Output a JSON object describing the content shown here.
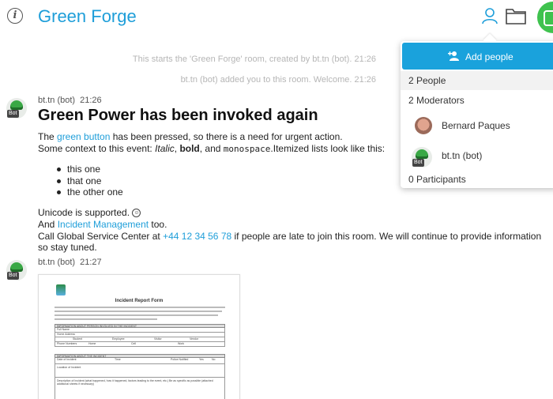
{
  "header": {
    "info_icon": "info-icon",
    "title": "Green Forge",
    "icons": [
      "person-icon",
      "folder-icon"
    ]
  },
  "system": {
    "created": "This starts the 'Green Forge' room, created by bt.tn (bot). 21:26",
    "added": "bt.tn (bot) added you to this room. Welcome. 21:26"
  },
  "message1": {
    "author": "bt.tn (bot)",
    "time": "21:26",
    "badge": "Bot",
    "heading": "Green Power has been invoked again",
    "line1_pre": "The ",
    "line1_link": "green button",
    "line1_post": " has been pressed, so there is a need for urgent action.",
    "line2_pre": "Some context to this event: ",
    "italic": "Italic",
    "sep1": ", ",
    "bold": "bold",
    "sep2": ", and ",
    "mono": "monospace",
    "line2_post": ".Itemized lists look like this:",
    "bullets": [
      "this one",
      "that one",
      "the other one"
    ],
    "unicode": "Unicode is supported.",
    "emoji": "☺",
    "and_pre": "And ",
    "and_link": "Incident Management",
    "and_post": " too.",
    "call_pre": "Call Global Service Center at ",
    "call_link": "+44 12 34 56 78",
    "call_post": " if people are late to join this room. We will continue to provide information",
    "call_line2": "so stay tuned."
  },
  "message2": {
    "author": "bt.tn (bot)",
    "time": "21:27",
    "badge": "Bot",
    "attachment": {
      "title": "Incident Report Form",
      "section1": "INFORMATION ABOUT PERSON INVOLVED IN THE INCIDENT",
      "full_name": "Full Name",
      "home_address": "Home Address",
      "roles": [
        "Student",
        "Employee",
        "Visitor",
        "Vendor"
      ],
      "phone": "Phone Numbers",
      "phone_cols": [
        "Home",
        "Cell",
        "Work"
      ],
      "section2": "INFORMATION ABOUT THE INCIDENT",
      "date": "Date of Incident",
      "time": "Time",
      "police": "Police Notified",
      "yes": "Yes",
      "no": "No",
      "location": "Location of Incident",
      "description": "Description of Incident (what happened, how it happened, factors leading to the event, etc.) Be as specific as possible (attached additional sheets if necessary)"
    }
  },
  "panel": {
    "add_label": "Add people",
    "people_count": "2 People",
    "moderators": "2 Moderators",
    "members": [
      {
        "name": "Bernard Paques"
      },
      {
        "name": "bt.tn (bot)",
        "badge": "Bot"
      }
    ],
    "participants": "0 Participants"
  },
  "colors": {
    "accent": "#1e9ed9",
    "button": "#1aa2dc",
    "avatar_green": "#3fc24e"
  }
}
